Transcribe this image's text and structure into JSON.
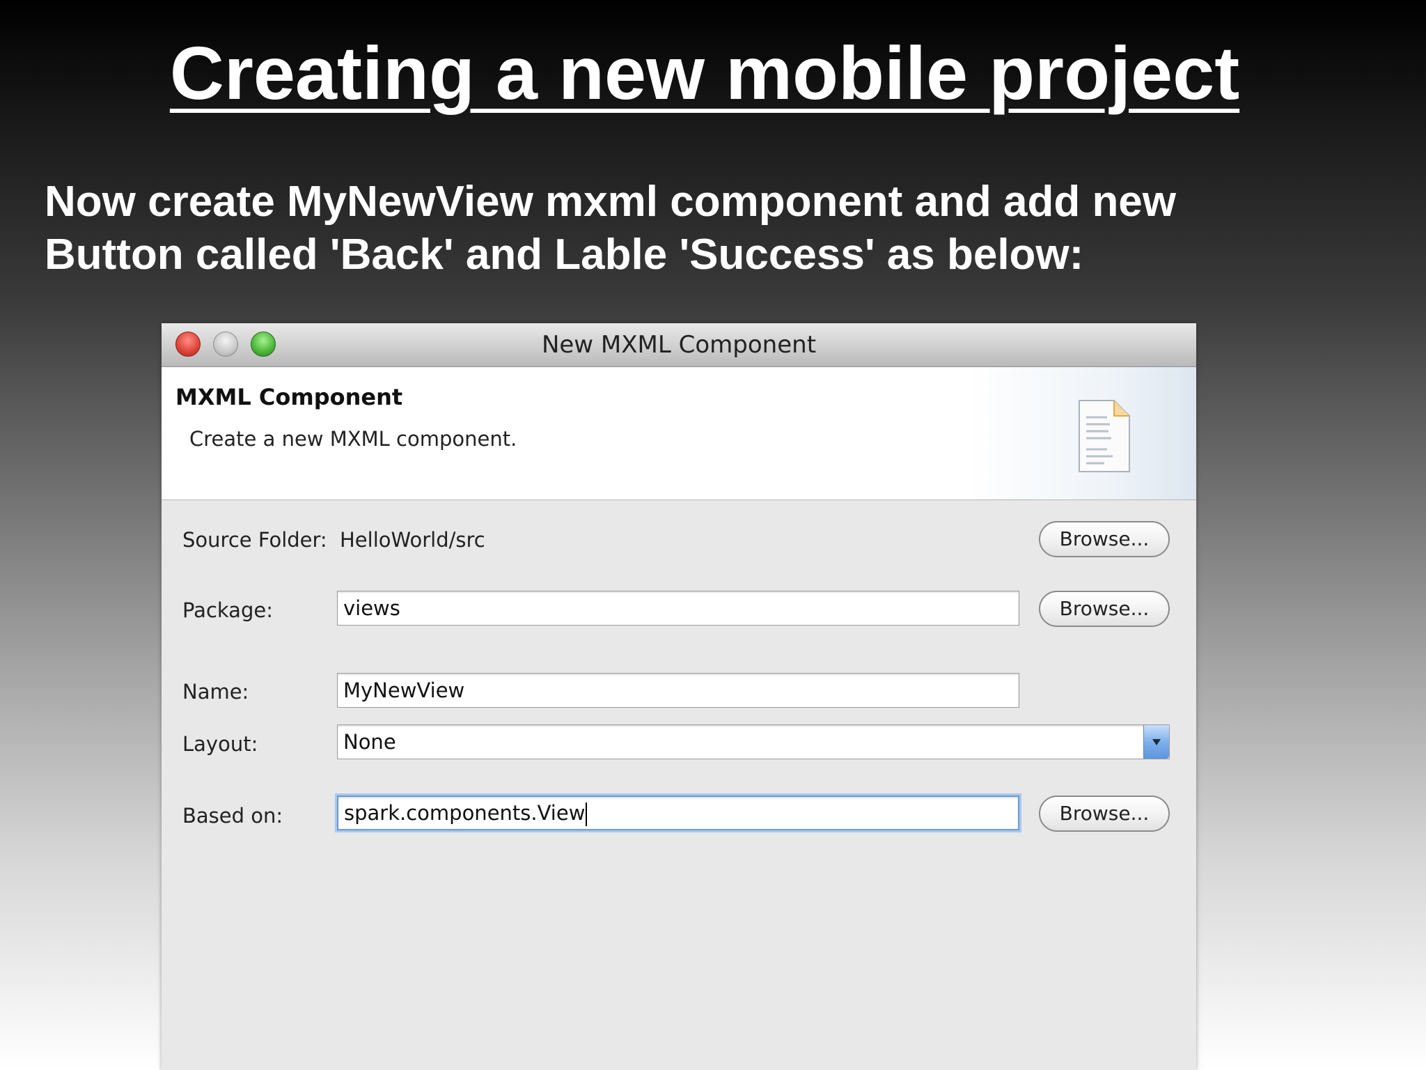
{
  "slide": {
    "title": "Creating a new mobile project",
    "text_line1": "Now create MyNewView mxml component and add new",
    "text_line2": "Button called 'Back' and Lable 'Success' as below:"
  },
  "dialog": {
    "window_title": "New MXML Component",
    "header": {
      "title": "MXML Component",
      "description": "Create a new MXML component.",
      "icon": "document-icon"
    },
    "fields": {
      "source_folder": {
        "label": "Source Folder:",
        "value": "HelloWorld/src",
        "browse_label": "Browse..."
      },
      "package": {
        "label": "Package:",
        "value": "views",
        "browse_label": "Browse..."
      },
      "name": {
        "label": "Name:",
        "value": "MyNewView"
      },
      "layout": {
        "label": "Layout:",
        "value": "None"
      },
      "based_on": {
        "label": "Based on:",
        "value": "spark.components.View",
        "browse_label": "Browse..."
      }
    },
    "colors": {
      "close_button": "#e0473c",
      "zoom_button": "#4fbb3c",
      "focus_ring": "#6d9bd1"
    }
  }
}
